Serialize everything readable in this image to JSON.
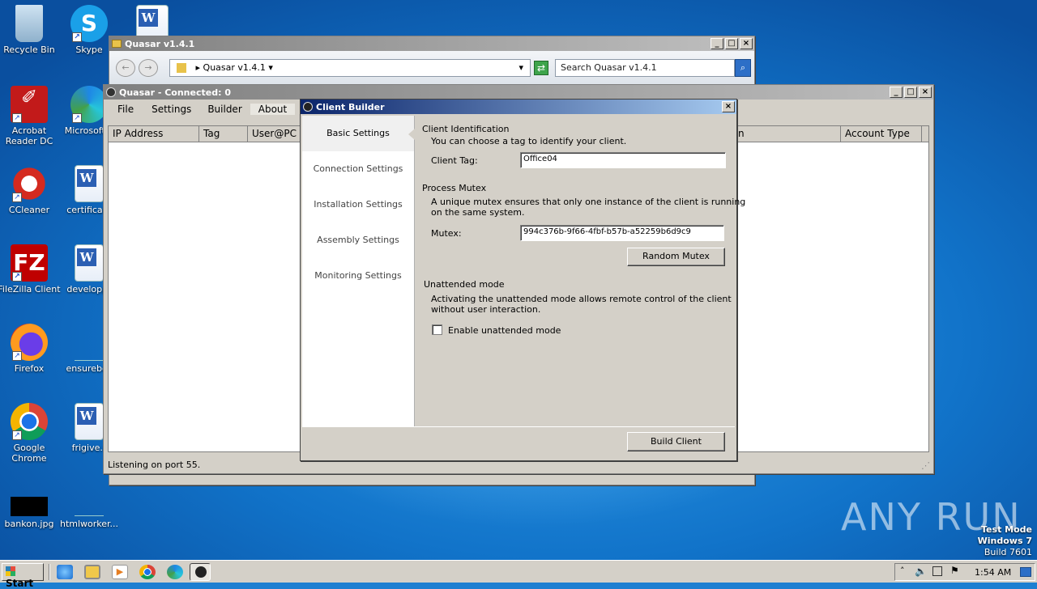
{
  "desktop": {
    "icons": [
      {
        "label": "Recycle Bin"
      },
      {
        "label": "Skype"
      },
      {
        "label": "Acrobat Reader DC"
      },
      {
        "label": "Microsoft E"
      },
      {
        "label": "CCleaner"
      },
      {
        "label": "certificate"
      },
      {
        "label": "FileZilla Client"
      },
      {
        "label": "developpr"
      },
      {
        "label": "Firefox"
      },
      {
        "label": "ensurebos"
      },
      {
        "label": "Google Chrome"
      },
      {
        "label": "frigive.r"
      },
      {
        "label": "bankon.jpg"
      },
      {
        "label": "htmlworker..."
      }
    ],
    "watermark": "ANY RUN",
    "test_mode": {
      "line1": "Test Mode",
      "line2": "Windows 7",
      "line3": "Build 7601"
    }
  },
  "explorer": {
    "title": "Quasar v1.4.1",
    "address": "Quasar v1.4.1",
    "search_placeholder": "Search Quasar v1.4.1"
  },
  "quasar": {
    "title": "Quasar - Connected: 0",
    "menu": [
      "File",
      "Settings",
      "Builder",
      "About"
    ],
    "columns": {
      "ip": "IP Address",
      "tag": "Tag",
      "user": "User@PC",
      "hidden": "n",
      "account": "Account Type"
    },
    "status": "Listening on port 55."
  },
  "builder": {
    "title": "Client Builder",
    "nav": [
      "Basic Settings",
      "Connection Settings",
      "Installation Settings",
      "Assembly Settings",
      "Monitoring Settings"
    ],
    "client_id": {
      "heading": "Client Identification",
      "desc": "You can choose a tag to identify your client.",
      "tag_label": "Client Tag:",
      "tag_value": "Office04"
    },
    "mutex": {
      "heading": "Process Mutex",
      "desc1": "A unique mutex ensures that only one instance of the client is running",
      "desc2": "on the same system.",
      "label": "Mutex:",
      "value": "994c376b-9f66-4fbf-b57b-a52259b6d9c9",
      "random_button": "Random Mutex"
    },
    "unattended": {
      "heading": "Unattended mode",
      "desc1": "Activating the unattended mode allows remote control of the client",
      "desc2": "without user interaction.",
      "checkbox_label": "Enable unattended mode",
      "checked": false
    },
    "build_button": "Build Client"
  },
  "taskbar": {
    "start": "Start",
    "clock": "1:54 AM"
  }
}
